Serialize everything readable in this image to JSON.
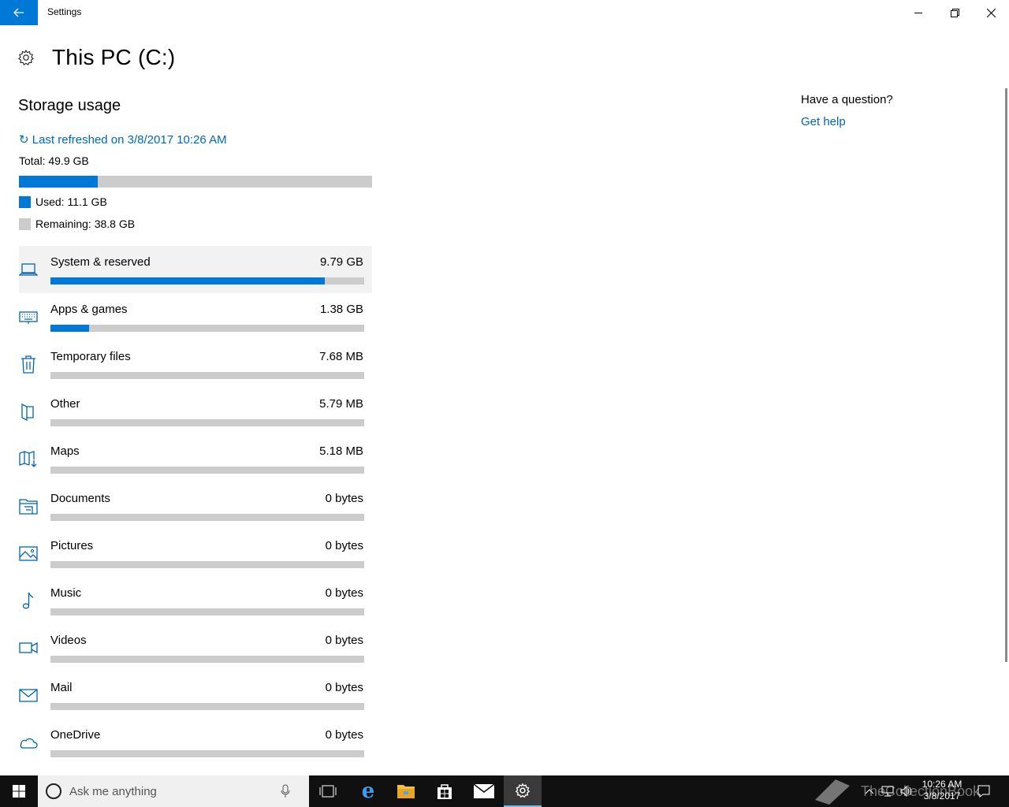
{
  "window": {
    "title": "Settings"
  },
  "header": {
    "title": "This PC (C:)"
  },
  "storage": {
    "section_title": "Storage usage",
    "refresh_text": "↻ Last refreshed on 3/8/2017 10:26 AM",
    "total_label": "Total: 49.9 GB",
    "used_fraction": 0.2224,
    "used_label": "Used: 11.1 GB",
    "remaining_label": "Remaining: 38.8 GB",
    "colors": {
      "used": "#0078d7",
      "remaining": "#cccccc",
      "accent": "#0078d7"
    }
  },
  "categories": [
    {
      "name": "System & reserved",
      "size": "9.79 GB",
      "fraction": 0.874,
      "icon": "laptop-icon"
    },
    {
      "name": "Apps & games",
      "size": "1.38 GB",
      "fraction": 0.123,
      "icon": "keyboard-icon"
    },
    {
      "name": "Temporary files",
      "size": "7.68 MB",
      "fraction": 0.0,
      "icon": "trash-icon"
    },
    {
      "name": "Other",
      "size": "5.79 MB",
      "fraction": 0.0,
      "icon": "other-folder-icon"
    },
    {
      "name": "Maps",
      "size": "5.18 MB",
      "fraction": 0.0,
      "icon": "map-icon"
    },
    {
      "name": "Documents",
      "size": "0 bytes",
      "fraction": 0.0,
      "icon": "documents-icon"
    },
    {
      "name": "Pictures",
      "size": "0 bytes",
      "fraction": 0.0,
      "icon": "picture-icon"
    },
    {
      "name": "Music",
      "size": "0 bytes",
      "fraction": 0.0,
      "icon": "music-note-icon"
    },
    {
      "name": "Videos",
      "size": "0 bytes",
      "fraction": 0.0,
      "icon": "video-camera-icon"
    },
    {
      "name": "Mail",
      "size": "0 bytes",
      "fraction": 0.0,
      "icon": "mail-icon"
    },
    {
      "name": "OneDrive",
      "size": "0 bytes",
      "fraction": 0.0,
      "icon": "cloud-icon"
    }
  ],
  "help": {
    "question": "Have a question?",
    "link": "Get help"
  },
  "taskbar": {
    "search_placeholder": "Ask me anything",
    "time": "10:26 AM",
    "date": "3/8/2017",
    "watermark": "TheCollectionBook"
  }
}
